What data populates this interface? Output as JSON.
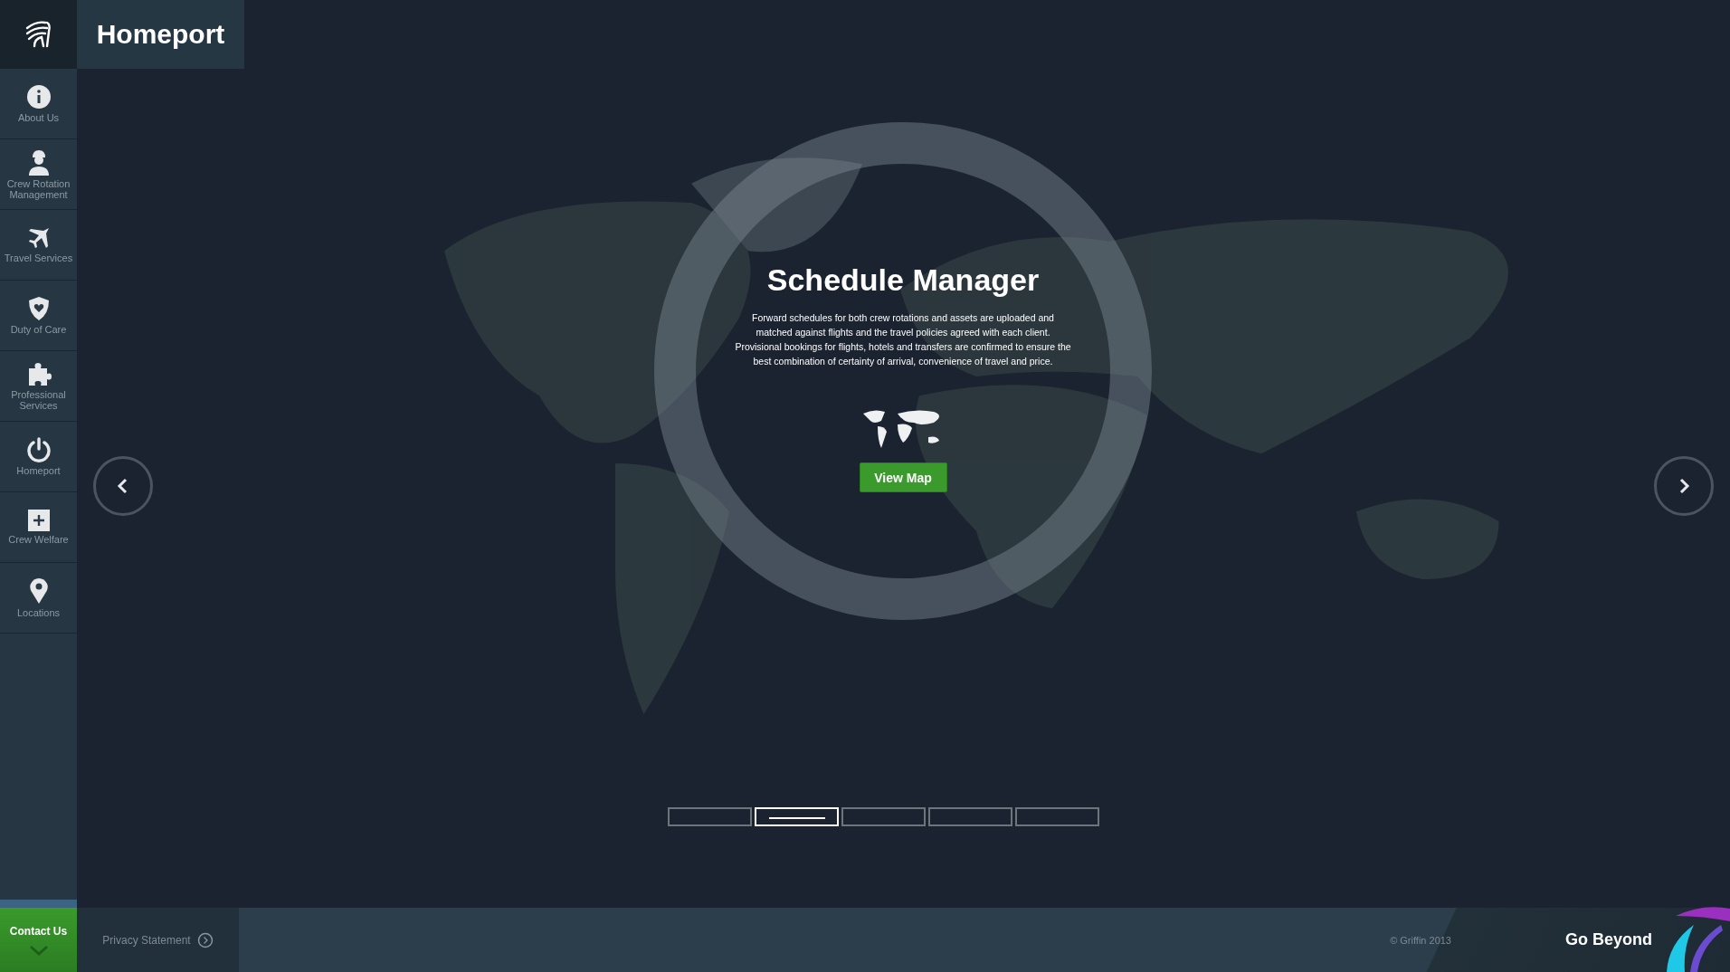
{
  "header": {
    "title": "Homeport"
  },
  "sidebar": {
    "items": [
      {
        "kind": "info",
        "label": "About Us"
      },
      {
        "kind": "worker",
        "label": "Crew Rotation Management"
      },
      {
        "kind": "plane",
        "label": "Travel Services"
      },
      {
        "kind": "shield",
        "label": "Duty of Care"
      },
      {
        "kind": "puzzle",
        "label": "Professional Services"
      },
      {
        "kind": "power",
        "label": "Homeport"
      },
      {
        "kind": "plus",
        "label": "Crew Welfare"
      },
      {
        "kind": "pin",
        "label": "Locations"
      }
    ]
  },
  "slide": {
    "title": "Schedule Manager",
    "text": "Forward schedules for both crew rotations and assets are uploaded and matched against flights and the travel policies agreed with each client. Provisional bookings for flights, hotels and transfers are confirmed to ensure the best combination of certainty of arrival, convenience of travel and price.",
    "button": "View Map"
  },
  "pagination": [
    {
      "selected": false
    },
    {
      "selected": true
    },
    {
      "selected": false
    },
    {
      "selected": false
    },
    {
      "selected": false
    }
  ],
  "footer": {
    "contact": "Contact Us",
    "privacy": "Privacy Statement",
    "copyright": "© Griffin 2013",
    "tagline": "Go Beyond"
  }
}
